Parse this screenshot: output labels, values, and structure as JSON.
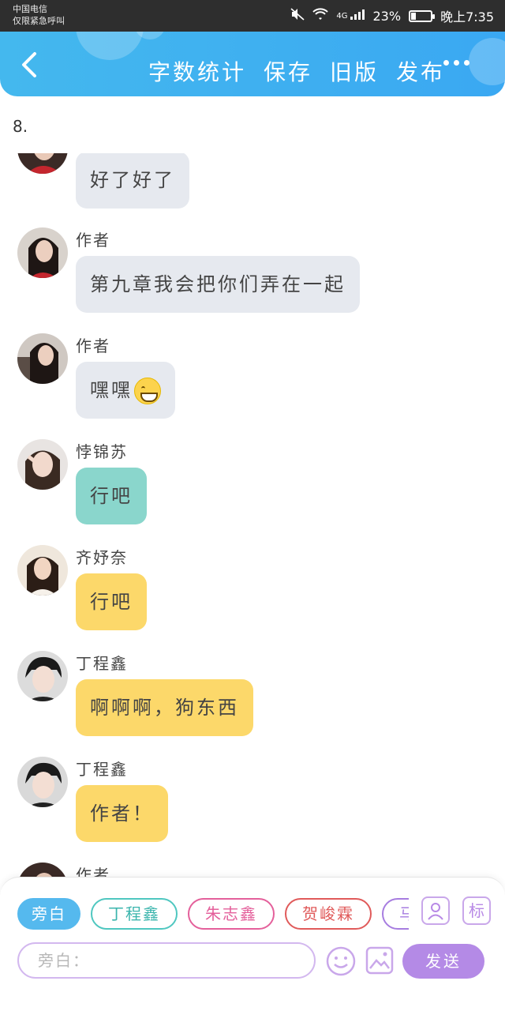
{
  "status_bar": {
    "carrier_line1": "中国电信",
    "carrier_line2": "仅限紧急呼叫",
    "network": "4G",
    "battery": "23%",
    "battery_level": 0.23,
    "time": "晚上7:35"
  },
  "navbar": {
    "items": [
      "字数统计",
      "保存",
      "旧版",
      "发布"
    ]
  },
  "chapter_number": "8.",
  "messages": [
    {
      "name": "",
      "text": "好了好了",
      "style": "gray"
    },
    {
      "name": "作者",
      "text": "第九章我会把你们弄在一起",
      "style": "gray"
    },
    {
      "name": "作者",
      "text": "嘿嘿",
      "emoji": "grin-emoji",
      "style": "gray"
    },
    {
      "name": "悖锦苏",
      "text": "行吧",
      "style": "teal"
    },
    {
      "name": "齐妤奈",
      "text": "行吧",
      "style": "yellow"
    },
    {
      "name": "丁程鑫",
      "text": "啊啊啊，狗东西",
      "style": "yellow"
    },
    {
      "name": "丁程鑫",
      "text": "作者！",
      "style": "yellow"
    },
    {
      "name": "作者",
      "text": "",
      "style": "gray"
    }
  ],
  "composer": {
    "roles": [
      {
        "label": "旁白",
        "color": "#55b9ee",
        "active": true
      },
      {
        "label": "丁程鑫",
        "color": "#4fc7c0",
        "active": false
      },
      {
        "label": "朱志鑫",
        "color": "#e4609b",
        "active": false
      },
      {
        "label": "贺峻霖",
        "color": "#e05a5a",
        "active": false
      },
      {
        "label": "马嘉祺",
        "color": "#a77de0",
        "active": false
      }
    ],
    "tag_label": "标",
    "input_placeholder": "旁白：",
    "send_label": "发送"
  },
  "colors": {
    "header": "#3aa8f2",
    "bubble_gray": "#e6e9ef",
    "bubble_teal": "#8ad6cc",
    "bubble_yellow": "#fcd86a",
    "send_button": "#b48ae6"
  }
}
